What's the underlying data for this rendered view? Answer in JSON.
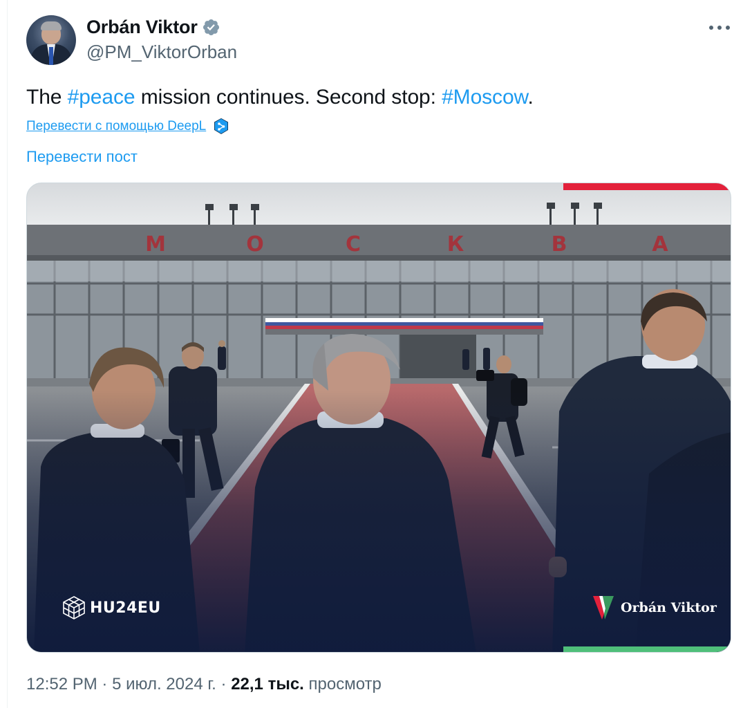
{
  "author": {
    "display_name": "Orbán Viktor",
    "handle": "@PM_ViktorOrban",
    "verified_color": "#829aab"
  },
  "tweet": {
    "text_part1": "The ",
    "hashtag1": "#peace",
    "text_part2": " mission continues. Second stop: ",
    "hashtag2": "#Moscow",
    "text_part3": ".",
    "deepl_link": "Перевести с помощью DeepL",
    "translate_post": "Перевести пост"
  },
  "media": {
    "building_sign": [
      "М",
      "О",
      "С",
      "К",
      "В",
      "А"
    ],
    "watermark_left": "HU24EU",
    "watermark_right": "Orbán Viktor",
    "accent_colors": {
      "red": "#e3213b",
      "green": "#4fbf7a",
      "navy": "#101c3d"
    }
  },
  "footer": {
    "time": "12:52 PM",
    "sep1": " · ",
    "date": "5 июл. 2024 г.",
    "sep2": " · ",
    "views_count": "22,1 тыс.",
    "views_label": " просмотр"
  },
  "colors": {
    "link": "#1d9bf0",
    "secondary_text": "#536471",
    "primary_text": "#0f1419"
  }
}
